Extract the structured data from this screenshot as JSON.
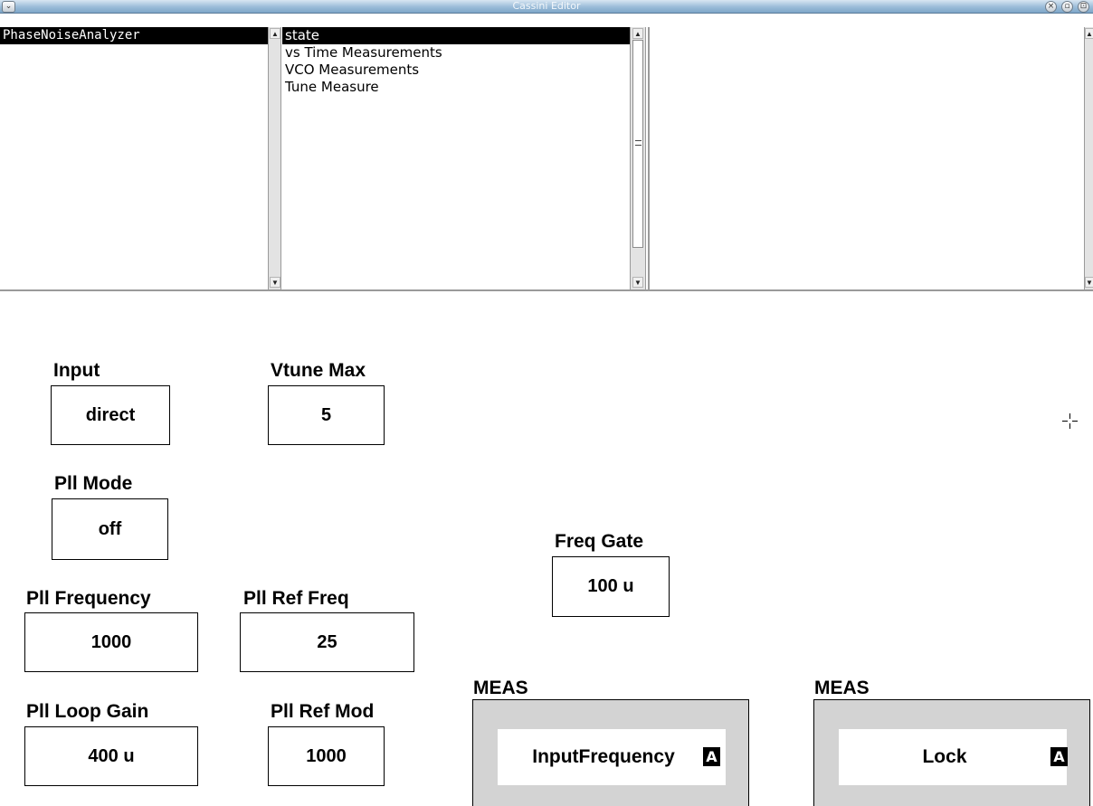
{
  "window": {
    "title": "Cassini Editor",
    "buttons": {
      "close": "×",
      "minimize": "▫",
      "maximize": "⊡",
      "menu": "⌄"
    }
  },
  "tree_pane": {
    "items": [
      {
        "label": "PhaseNoiseAnalyzer",
        "selected": true
      }
    ]
  },
  "category_pane": {
    "items": [
      {
        "label": "state",
        "selected": true
      },
      {
        "label": "vs Time Measurements",
        "selected": false
      },
      {
        "label": "VCO Measurements",
        "selected": false
      },
      {
        "label": "Tune Measure",
        "selected": false
      }
    ]
  },
  "scroll_arrows": {
    "up": "▲",
    "down": "▼"
  },
  "fields": {
    "input": {
      "label": "Input",
      "value": "direct"
    },
    "vtune_max": {
      "label": "Vtune Max",
      "value": "5"
    },
    "pll_mode": {
      "label": "Pll Mode",
      "value": "off"
    },
    "freq_gate": {
      "label": "Freq Gate",
      "value": "100 u"
    },
    "pll_frequency": {
      "label": "Pll Frequency",
      "value": "1000"
    },
    "pll_ref_freq": {
      "label": "Pll Ref Freq",
      "value": "25"
    },
    "pll_loop_gain": {
      "label": "Pll Loop Gain",
      "value": "400 u"
    },
    "pll_ref_mod": {
      "label": "Pll Ref Mod",
      "value": "1000"
    }
  },
  "measurements": [
    {
      "label": "MEAS",
      "value": "InputFrequency",
      "badge": "A"
    },
    {
      "label": "MEAS",
      "value": "Lock",
      "badge": "A"
    }
  ],
  "colors": {
    "title_bar": "#9bbcd8",
    "selection": "#000000",
    "meas_frame": "#d3d3d3"
  }
}
